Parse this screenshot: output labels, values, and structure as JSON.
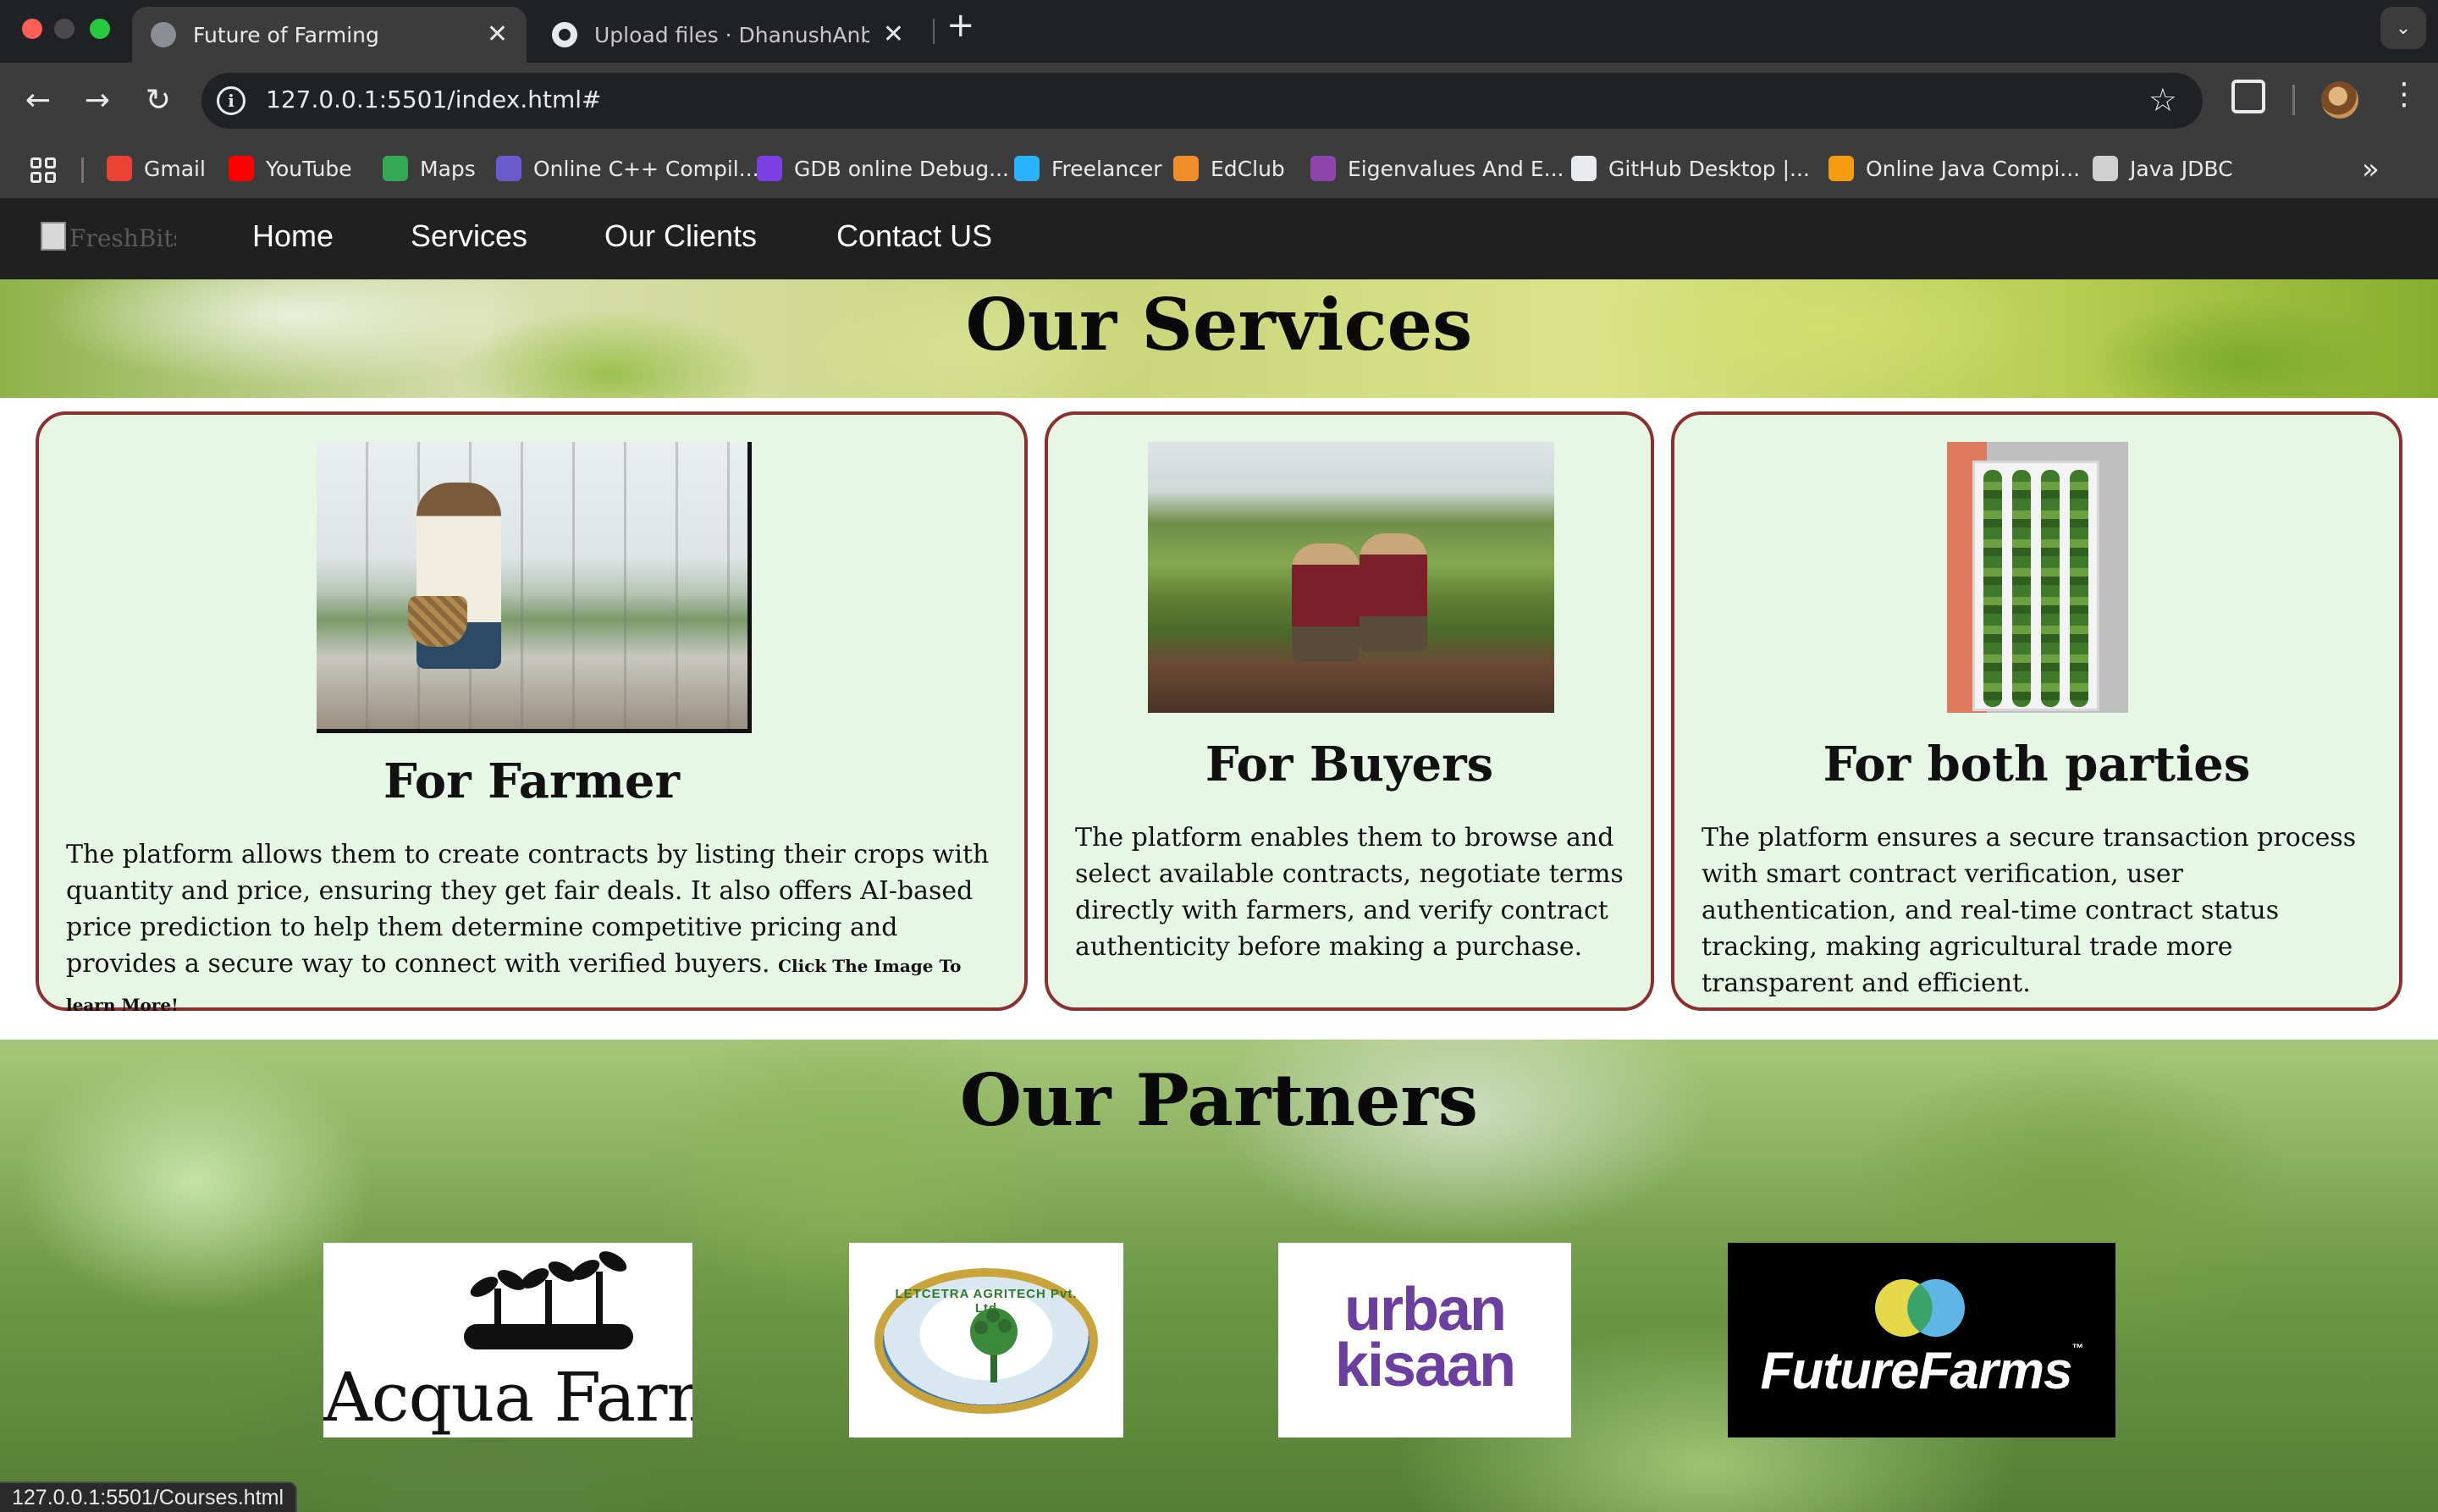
{
  "browser": {
    "tabs": [
      {
        "title": "Future of Farming",
        "favicon": "globe-icon",
        "active": true
      },
      {
        "title": "Upload files · DhanushAnbalagan",
        "favicon": "github-icon",
        "active": false
      }
    ],
    "close_glyph": "✕",
    "new_tab_glyph": "+",
    "tab_search_glyph": "⌄",
    "nav": {
      "back": "←",
      "forward": "→",
      "reload": "↻"
    },
    "url": "127.0.0.1:5501/index.html#",
    "info_glyph": "i",
    "star_glyph": "☆",
    "menu_glyph": "⋮",
    "more_bookmarks_glyph": "»",
    "bookmarks": [
      {
        "label": "Gmail",
        "icon": "gmail-icon",
        "color": "#ea4335"
      },
      {
        "label": "YouTube",
        "icon": "youtube-icon",
        "color": "#ff0000"
      },
      {
        "label": "Maps",
        "icon": "maps-icon",
        "color": "#34a853"
      },
      {
        "label": "Online C++ Compil...",
        "icon": "cpp-compiler-icon",
        "color": "#6a5acd"
      },
      {
        "label": "GDB online Debug...",
        "icon": "gdb-icon",
        "color": "#7b3fe4"
      },
      {
        "label": "Freelancer",
        "icon": "freelancer-icon",
        "color": "#29b2fe"
      },
      {
        "label": "EdClub",
        "icon": "edclub-icon",
        "color": "#f28c28"
      },
      {
        "label": "Eigenvalues And E...",
        "icon": "eigenvalues-icon",
        "color": "#8e44ad"
      },
      {
        "label": "GitHub Desktop |...",
        "icon": "github-icon",
        "color": "#e8eaed"
      },
      {
        "label": "Online Java Compi...",
        "icon": "java-compiler-icon",
        "color": "#f39c12"
      },
      {
        "label": "Java JDBC",
        "icon": "java-jdbc-icon",
        "color": "#d0d0d0"
      }
    ],
    "status_url": "127.0.0.1:5501/Courses.html"
  },
  "site": {
    "logo_alt": "FreshBits",
    "nav": [
      "Home",
      "Services",
      "Our Clients",
      "Contact US"
    ],
    "services_title": "Our Services",
    "cards": [
      {
        "title": "For Farmer",
        "text": "The platform allows them to create contracts by listing their crops with quantity and price, ensuring they get fair deals. It also offers AI-based price prediction to help them determine competitive pricing and provides a secure way to connect with verified buyers.",
        "note": "Click The Image To learn More!",
        "image": "greenhouse-farmer-photo"
      },
      {
        "title": "For Buyers",
        "text": "The platform enables them to browse and select available contracts, negotiate terms directly with farmers, and verify contract authenticity before making a purchase.",
        "image": "field-workers-photo"
      },
      {
        "title": "For both parties",
        "text": "The platform ensures a secure transaction process with smart contract verification, user authentication, and real-time contract status tracking, making agricultural trade more transparent and efficient.",
        "image": "vertical-garden-photo"
      }
    ],
    "partners_title": "Our Partners",
    "partners": [
      {
        "name": "Acqua Farms"
      },
      {
        "name": "LETCETRA AGRITECH Pvt. Ltd"
      },
      {
        "name": "urban\nkisaan"
      },
      {
        "name": "FutureFarms",
        "tm": "™"
      }
    ],
    "colors": {
      "nav_bg": "#202020",
      "card_bg": "#e6f7e6",
      "card_border": "#8b2f2f",
      "urban_purple": "#6b3fa0"
    }
  }
}
